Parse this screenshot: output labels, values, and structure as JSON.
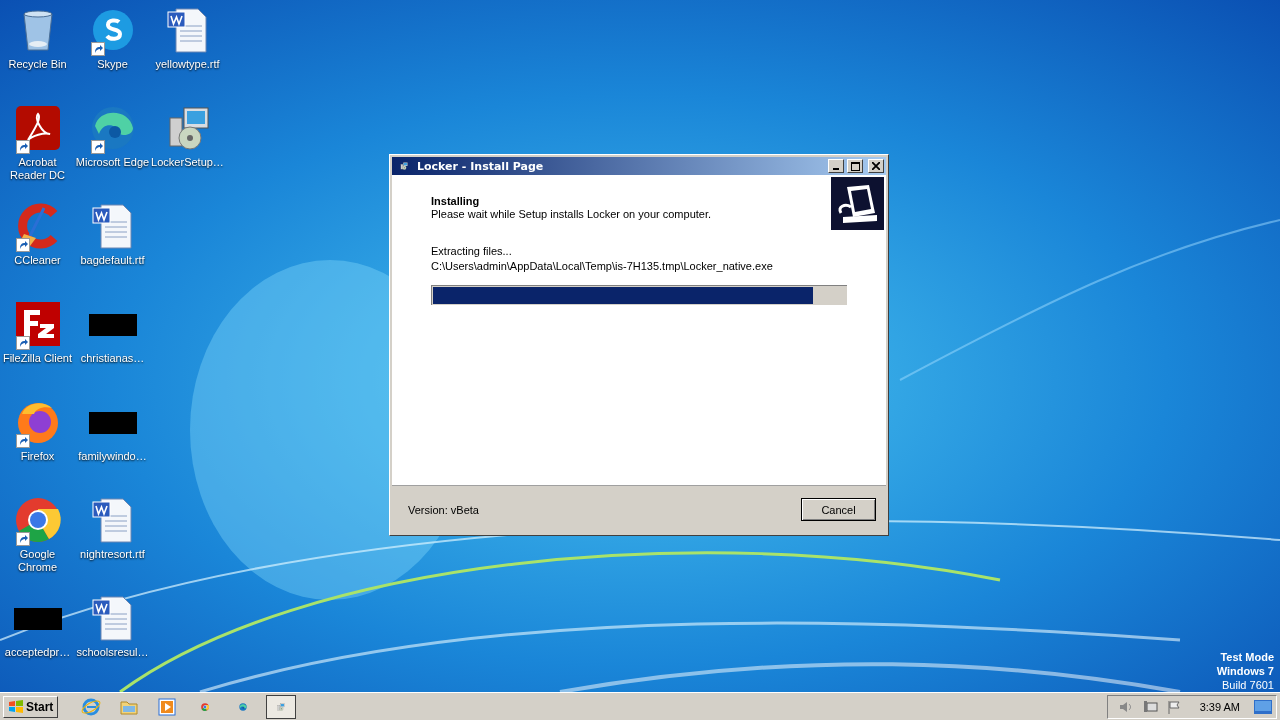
{
  "desktop": {
    "columns": [
      [
        {
          "label": "Recycle Bin",
          "kind": "recycle",
          "shortcut": false
        },
        {
          "label": "Acrobat Reader DC",
          "kind": "acrobat",
          "shortcut": true
        },
        {
          "label": "CCleaner",
          "kind": "ccleaner",
          "shortcut": true
        },
        {
          "label": "FileZilla Client",
          "kind": "filezilla",
          "shortcut": true
        },
        {
          "label": "Firefox",
          "kind": "firefox",
          "shortcut": true
        },
        {
          "label": "Google Chrome",
          "kind": "chrome",
          "shortcut": true
        },
        {
          "label": "acceptedpr…",
          "kind": "blank",
          "shortcut": false
        }
      ],
      [
        {
          "label": "Skype",
          "kind": "skype",
          "shortcut": true
        },
        {
          "label": "Microsoft Edge",
          "kind": "edge",
          "shortcut": true
        },
        {
          "label": "bagdefault.rtf",
          "kind": "word",
          "shortcut": false
        },
        {
          "label": "christianas…",
          "kind": "blank",
          "shortcut": false
        },
        {
          "label": "familywindo…",
          "kind": "blank",
          "shortcut": false
        },
        {
          "label": "nightresort.rtf",
          "kind": "word",
          "shortcut": false
        },
        {
          "label": "schoolsresul…",
          "kind": "word",
          "shortcut": false
        }
      ],
      [
        {
          "label": "yellowtype.rtf",
          "kind": "word",
          "shortcut": false
        },
        {
          "label": "LockerSetup…",
          "kind": "installer",
          "shortcut": false
        }
      ]
    ],
    "os_notice": [
      "Test Mode",
      "Windows 7",
      "Build 7601"
    ]
  },
  "window": {
    "title": "Locker - Install Page",
    "heading": "Installing",
    "subheading": "Please wait while Setup installs Locker on your computer.",
    "status": "Extracting files...",
    "file_path": "C:\\Users\\admin\\AppData\\Local\\Temp\\is-7H135.tmp\\Locker_native.exe",
    "progress": {
      "level": 0.92
    },
    "version": "Version: vBeta",
    "buttons": [
      "Cancel"
    ]
  },
  "taskbar": {
    "start": "Start",
    "items": [
      {
        "kind": "ie",
        "selected": false
      },
      {
        "kind": "folder",
        "selected": false
      },
      {
        "kind": "media",
        "selected": false
      },
      {
        "kind": "chrome",
        "selected": false
      },
      {
        "kind": "edge",
        "selected": false
      },
      {
        "kind": "installer",
        "selected": true
      }
    ],
    "clock": "3:39 AM"
  }
}
